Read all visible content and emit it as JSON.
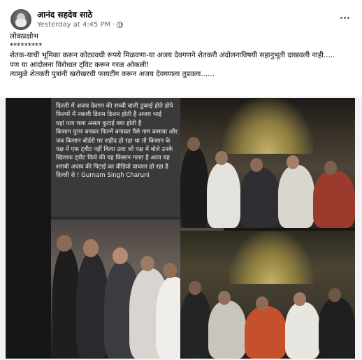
{
  "post": {
    "author": "आनंद सहदेव साठे",
    "timestamp": "Yesterday at 4:45 PM",
    "separator": "·",
    "icons": {
      "avatar": "profile-photo",
      "audience": "globe-icon",
      "menu": "more-options-icon"
    }
  },
  "body": {
    "lines": [
      "लोकप्रक्षोभ",
      "*********",
      "शेतक-याची भूमिका करून कोट्यवधी रूपये मिळवणा-या अजय देवगणने शेतकरी अंदोलनाविषयी सहानुभूती दाखवली नाही.....",
      "पण या आंदोलना विरोधात ट्विट करून गरळ ओकली!",
      "त्यामुळे शेतकरी पुत्रांनी खरोखरची फायटींग करून अजय देवगणला तुडवला......"
    ]
  },
  "image": {
    "caption_lines": [
      "दिल्ली में अजय देवगन की सच्ची वाली ठुकाई होते होये",
      "फिल्मों में नकली डिशम डिशम होती है अजय भाई",
      "यहां पता चला असल कुटाई क्या होती है",
      "किसान पुत्तर बनकर फिल्में बनाकर पैसे नाम कमाया और",
      "जब किसान बोर्डरो पर शहीद हो रहा था तो किसान  के",
      "पक्ष में एक ट्वीट नहीं किया उल्ट जो पक्ष में बोले उनके",
      "खिलाफ ट्वीट किये की यह किसान गलत है आज यह",
      "शराबी अजय की पिटाई का वीडियो वायरल हो रहा है",
      "दिल्ली से ! Gurnam Singh Charuni"
    ]
  }
}
